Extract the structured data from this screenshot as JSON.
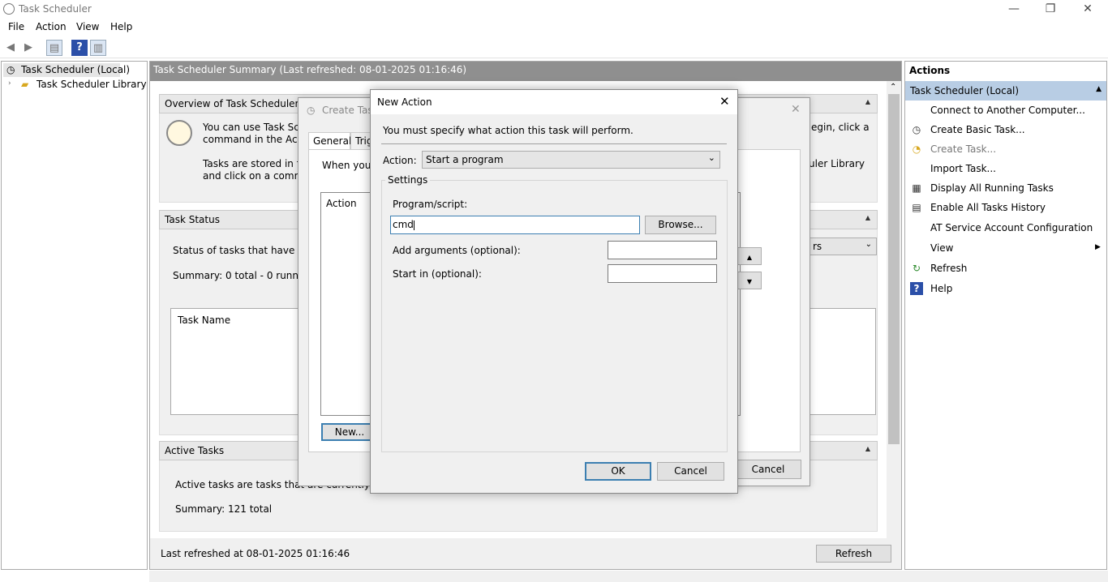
{
  "window": {
    "title": "Task Scheduler",
    "min": "—",
    "restore": "❐",
    "close": "✕"
  },
  "menu": [
    "File",
    "Action",
    "View",
    "Help"
  ],
  "tree": {
    "root": "Task Scheduler (Local)",
    "library": "Task Scheduler Library"
  },
  "center": {
    "header": "Task Scheduler Summary (Last refreshed: 08-01-2025 01:16:46)",
    "overview": {
      "title": "Overview of Task Scheduler",
      "line1": "You can use Task Sched",
      "line2": "command in the Actio",
      "line3": "Tasks are stored in fold",
      "line4": "and click on a comman",
      "right1": "egin, click a",
      "right2": "uler Library"
    },
    "status": {
      "title": "Task Status",
      "text": "Status of tasks that have starte",
      "summary": "Summary: 0 total - 0 running,",
      "combo": "rs",
      "col": "Task Name"
    },
    "active": {
      "title": "Active Tasks",
      "text": "Active tasks are tasks that are currently enabled",
      "summary": "Summary: 121 total"
    },
    "footer": "Last refreshed at 08-01-2025 01:16:46",
    "refresh": "Refresh"
  },
  "actions": {
    "title": "Actions",
    "group": "Task Scheduler (Local)",
    "items": [
      "Connect to Another Computer...",
      "Create Basic Task...",
      "Create Task...",
      "Import Task...",
      "Display All Running Tasks",
      "Enable All Tasks History",
      "AT Service Account Configuration",
      "View",
      "Refresh",
      "Help"
    ]
  },
  "create_task": {
    "title": "Create Task",
    "tabs": [
      "General",
      "Trig"
    ],
    "desc": "When you c",
    "list_header": "Action",
    "new_button": "New...",
    "cancel": "Cancel"
  },
  "new_action": {
    "title": "New Action",
    "instruction": "You must specify what action this task will perform.",
    "action_label": "Action:",
    "action_value": "Start a program",
    "settings": "Settings",
    "program_label": "Program/script:",
    "program_value": "cmd",
    "browse": "Browse...",
    "args_label": "Add arguments (optional):",
    "start_label": "Start in (optional):",
    "ok": "OK",
    "cancel": "Cancel"
  }
}
